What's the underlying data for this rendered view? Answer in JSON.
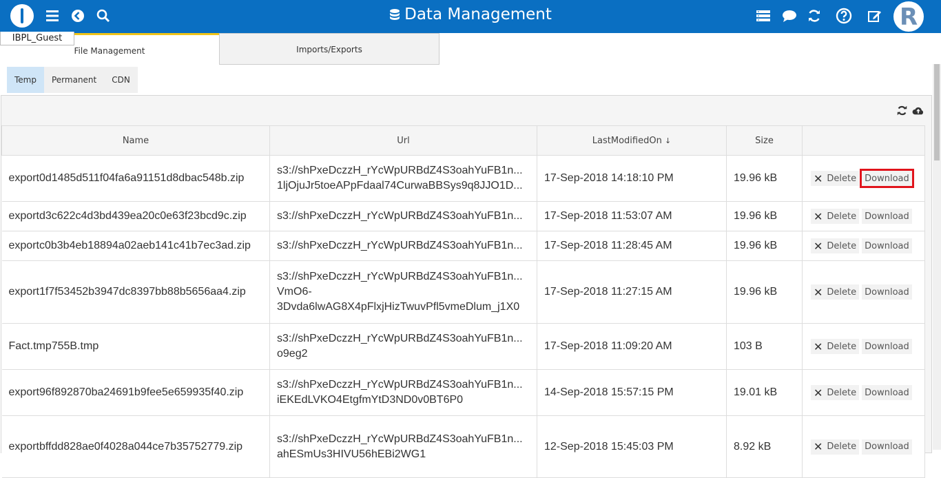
{
  "header": {
    "title": "Data Management",
    "icons": [
      "menu-icon",
      "back-icon",
      "search-icon",
      "list-icon",
      "chat-icon",
      "refresh-icon",
      "help-icon",
      "edit-icon"
    ],
    "avatar_letter": "R"
  },
  "user": {
    "name": "IBPL_Guest"
  },
  "tabs": [
    {
      "label": "File Management",
      "active": true
    },
    {
      "label": "Imports/Exports",
      "active": false
    }
  ],
  "subtabs": [
    {
      "label": "Temp",
      "active": true
    },
    {
      "label": "Permanent",
      "active": false
    },
    {
      "label": "CDN",
      "active": false
    }
  ],
  "table": {
    "columns": [
      "Name",
      "Url",
      "LastModifiedOn",
      "Size",
      ""
    ],
    "sort_indicator": "↓",
    "delete_label": "Delete",
    "download_label": "Download",
    "rows": [
      {
        "name": "export0d1485d511f04fa6a91151d8dbac548b.zip",
        "url": [
          "s3://shPxeDczzH_rYcWpURBdZ4S3oahYuFB1n...",
          "1ljOjuJr5toeAPpFdaal74CurwaBBSys9q8JJO1D..."
        ],
        "modified": "17-Sep-2018 14:18:10 PM",
        "size": "19.96 kB",
        "download_highlighted": true
      },
      {
        "name": "exportd3c622c4d3bd439ea20c0e63f23bcd9c.zip",
        "url": [
          "s3://shPxeDczzH_rYcWpURBdZ4S3oahYuFB1n..."
        ],
        "modified": "17-Sep-2018 11:53:07 AM",
        "size": "19.96 kB"
      },
      {
        "name": "exportc0b3b4eb18894a02aeb141c41b7ec3ad.zip",
        "url": [
          "s3://shPxeDczzH_rYcWpURBdZ4S3oahYuFB1n..."
        ],
        "modified": "17-Sep-2018 11:28:45 AM",
        "size": "19.96 kB"
      },
      {
        "name": "export1f7f53452b3947dc8397bb88b5656aa4.zip",
        "url": [
          "s3://shPxeDczzH_rYcWpURBdZ4S3oahYuFB1n...",
          "VmO6-",
          "3Dvda6lwAG8X4pFlxjHizTwuvPfl5vmeDlum_j1X0"
        ],
        "modified": "17-Sep-2018 11:27:15 AM",
        "size": "19.96 kB"
      },
      {
        "name": "Fact.tmp755B.tmp",
        "url": [
          "s3://shPxeDczzH_rYcWpURBdZ4S3oahYuFB1n...",
          "o9eg2"
        ],
        "modified": "17-Sep-2018 11:09:20 AM",
        "size": "103 B"
      },
      {
        "name": "export96f892870ba24691b9fee5e659935f40.zip",
        "url": [
          "s3://shPxeDczzH_rYcWpURBdZ4S3oahYuFB1n...",
          "iEKEdLVKO4EtgfmYtD3ND0v0BT6P0"
        ],
        "modified": "14-Sep-2018 15:57:15 PM",
        "size": "19.01 kB"
      },
      {
        "name": "exportbffdd828ae0f4028a044ce7b35752779.zip",
        "url": [
          "s3://shPxeDczzH_rYcWpURBdZ4S3oahYuFB1n...",
          "ahESmUs3HIVU56hEBi2WG1"
        ],
        "modified": "12-Sep-2018 15:45:03 PM",
        "size": "8.92 kB"
      }
    ]
  }
}
